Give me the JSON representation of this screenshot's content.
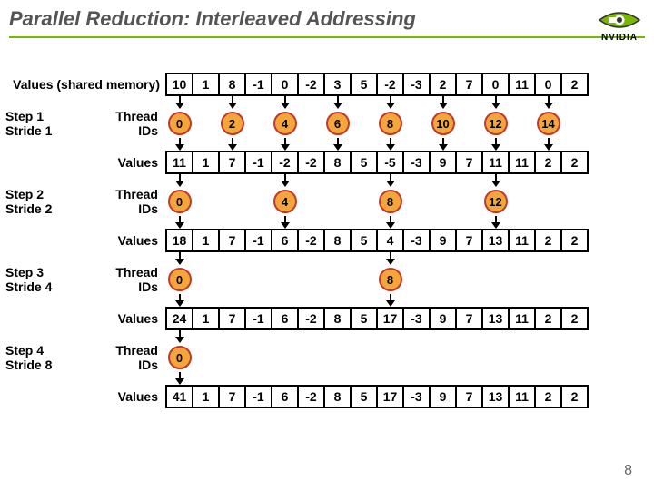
{
  "title": "Parallel Reduction: Interleaved Addressing",
  "brand": "NVIDIA",
  "pageNum": "8",
  "initialLabel": "Values (shared memory)",
  "initialValues": [
    10,
    1,
    8,
    -1,
    0,
    -2,
    3,
    5,
    -2,
    -3,
    2,
    7,
    0,
    11,
    0,
    2
  ],
  "steps": [
    {
      "step": "Step 1",
      "stride": "Stride 1",
      "tids": [
        0,
        2,
        4,
        6,
        8,
        10,
        12,
        14
      ],
      "values": [
        11,
        1,
        7,
        -1,
        -2,
        -2,
        8,
        5,
        -5,
        -3,
        9,
        7,
        11,
        11,
        2,
        2
      ]
    },
    {
      "step": "Step 2",
      "stride": "Stride 2",
      "tids": [
        0,
        4,
        8,
        12
      ],
      "values": [
        18,
        1,
        7,
        -1,
        6,
        -2,
        8,
        5,
        4,
        -3,
        9,
        7,
        13,
        11,
        2,
        2
      ]
    },
    {
      "step": "Step 3",
      "stride": "Stride 4",
      "tids": [
        0,
        8
      ],
      "values": [
        24,
        1,
        7,
        -1,
        6,
        -2,
        8,
        5,
        17,
        -3,
        9,
        7,
        13,
        11,
        2,
        2
      ]
    },
    {
      "step": "Step 4",
      "stride": "Stride 8",
      "tids": [
        0
      ],
      "values": [
        41,
        1,
        7,
        -1,
        6,
        -2,
        8,
        5,
        17,
        -3,
        9,
        7,
        13,
        11,
        2,
        2
      ]
    }
  ],
  "labels": {
    "threadIDs": "Thread\nIDs",
    "values": "Values"
  },
  "chart_data": {
    "type": "table",
    "title": "Parallel Reduction: Interleaved Addressing",
    "stages": [
      {
        "label": "Values (shared memory)",
        "values": [
          10,
          1,
          8,
          -1,
          0,
          -2,
          3,
          5,
          -2,
          -3,
          2,
          7,
          0,
          11,
          0,
          2
        ]
      },
      {
        "label": "Step 1 Stride 1",
        "active_threads": [
          0,
          2,
          4,
          6,
          8,
          10,
          12,
          14
        ],
        "values": [
          11,
          1,
          7,
          -1,
          -2,
          -2,
          8,
          5,
          -5,
          -3,
          9,
          7,
          11,
          11,
          2,
          2
        ]
      },
      {
        "label": "Step 2 Stride 2",
        "active_threads": [
          0,
          4,
          8,
          12
        ],
        "values": [
          18,
          1,
          7,
          -1,
          6,
          -2,
          8,
          5,
          4,
          -3,
          9,
          7,
          13,
          11,
          2,
          2
        ]
      },
      {
        "label": "Step 3 Stride 4",
        "active_threads": [
          0,
          8
        ],
        "values": [
          24,
          1,
          7,
          -1,
          6,
          -2,
          8,
          5,
          17,
          -3,
          9,
          7,
          13,
          11,
          2,
          2
        ]
      },
      {
        "label": "Step 4 Stride 8",
        "active_threads": [
          0
        ],
        "values": [
          41,
          1,
          7,
          -1,
          6,
          -2,
          8,
          5,
          17,
          -3,
          9,
          7,
          13,
          11,
          2,
          2
        ]
      }
    ]
  }
}
